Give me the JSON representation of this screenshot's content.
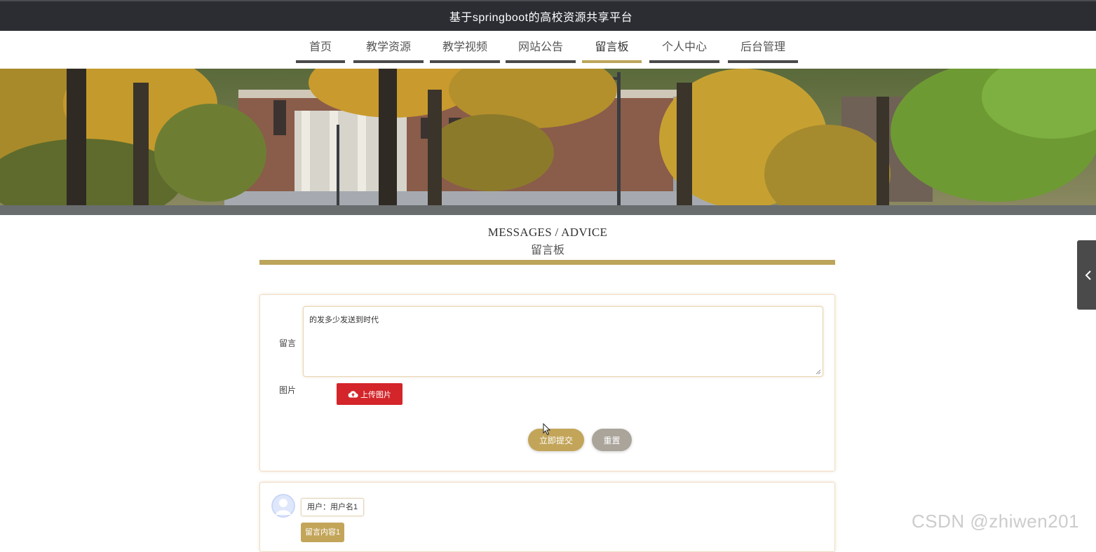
{
  "header": {
    "title": "基于springboot的高校资源共享平台"
  },
  "nav": {
    "items": [
      {
        "label": "首页"
      },
      {
        "label": "教学资源"
      },
      {
        "label": "教学视频"
      },
      {
        "label": "网站公告"
      },
      {
        "label": "留言板",
        "active": true
      },
      {
        "label": "个人中心"
      },
      {
        "label": "后台管理"
      }
    ]
  },
  "section": {
    "title_en": "MESSAGES / ADVICE",
    "title_cn": "留言板"
  },
  "form": {
    "message_label": "留言",
    "message_value": "的发多少发送到时代",
    "image_label": "图片",
    "upload_label": "上传图片",
    "submit_label": "立即提交",
    "reset_label": "重置"
  },
  "comments": [
    {
      "user": "用户：用户名1",
      "content": "留言内容1"
    }
  ],
  "watermark": "CSDN @zhiwen201",
  "colors": {
    "accent": "#bca55a",
    "header_bg": "#2b2d33",
    "upload_red": "#d3252a",
    "reset_gray": "#aaa49b"
  }
}
